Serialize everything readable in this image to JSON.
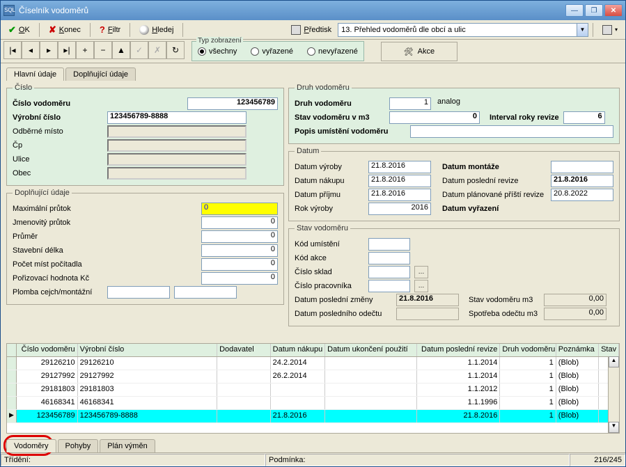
{
  "window": {
    "title": "Číselník vodoměrů"
  },
  "toolbar": {
    "ok": "OK",
    "konec": "Konec",
    "filtr": "Filtr",
    "hledej": "Hledej",
    "predtisk": "Předtisk",
    "predtisk_combo": "13. Přehled vodoměrů dle obcí a ulic"
  },
  "typ": {
    "legend": "Typ zobrazení",
    "vsechny": "všechny",
    "vyrazene": "vyřazené",
    "nevyrazene": "nevyřazené"
  },
  "akce": "Akce",
  "tabs": {
    "hlavni": "Hlavní údaje",
    "dopln": "Doplňující údaje"
  },
  "cislo": {
    "legend": "Číslo",
    "cislo_vodomeru_lbl": "Číslo vodoměru",
    "cislo_vodomeru": "123456789",
    "vyrobni_cislo_lbl": "Výrobní číslo",
    "vyrobni_cislo": "123456789-8888",
    "odberne_misto_lbl": "Odběrné místo",
    "cp_lbl": "Čp",
    "ulice_lbl": "Ulice",
    "obec_lbl": "Obec"
  },
  "dopln": {
    "legend": "Doplňující údaje",
    "max_prutok_lbl": "Maximální průtok",
    "max_prutok": "0",
    "jmen_prutok_lbl": "Jmenovitý průtok",
    "jmen_prutok": "0",
    "prumer_lbl": "Průměr",
    "prumer": "0",
    "stav_delka_lbl": "Stavební délka",
    "stav_delka": "0",
    "pocet_mist_lbl": "Počet míst počítadla",
    "pocet_mist": "0",
    "poriz_lbl": "Pořizovací hodnota Kč",
    "poriz": "0",
    "plomba_lbl": "Plomba cejch/montážní"
  },
  "druh": {
    "legend": "Druh vodoměru",
    "druh_lbl": "Druh vodoměru",
    "druh_id": "1",
    "druh_name": "analog",
    "stav_lbl": "Stav vodoměru v m3",
    "stav": "0",
    "interval_lbl": "Interval roky revize",
    "interval": "6",
    "popis_lbl": "Popis umístění vodoměru"
  },
  "datum": {
    "legend": "Datum",
    "vyroby_lbl": "Datum výroby",
    "vyroby": "21.8.2016",
    "nakupu_lbl": "Datum nákupu",
    "nakupu": "21.8.2016",
    "prijmu_lbl": "Datum příjmu",
    "prijmu": "21.8.2016",
    "rok_lbl": "Rok výroby",
    "rok": "2016",
    "montaze_lbl": "Datum montáže",
    "posledni_lbl": "Datum poslední revize",
    "posledni": "21.8.2016",
    "plan_lbl": "Datum plánované příští revize",
    "plan": "20.8.2022",
    "vyrazeni_lbl": "Datum vyřazení"
  },
  "stavv": {
    "legend": "Stav vodoměru",
    "kod_um_lbl": "Kód umístění",
    "kod_akce_lbl": "Kód akce",
    "cislo_sklad_lbl": "Číslo sklad",
    "cislo_prac_lbl": "Číslo pracovníka",
    "datum_zmeny_lbl": "Datum poslední změny",
    "datum_zmeny": "21.8.2016",
    "datum_odectu_lbl": "Datum posledního odečtu",
    "stav_m3_lbl": "Stav vodoměru m3",
    "stav_m3": "0,00",
    "spotreba_lbl": "Spotřeba  odečtu m3",
    "spotreba": "0,00"
  },
  "grid": {
    "headers": [
      "Číslo vodoměru",
      "Výrobní číslo",
      "Dodavatel",
      "Datum nákupu",
      "Datum ukončení použití",
      "Datum poslední revize",
      "Druh vodoměru",
      "Poznámka",
      "Stav"
    ],
    "rows": [
      {
        "c": "29126210",
        "v": "29126210",
        "d": "",
        "dn": "24.2.2014",
        "du": "",
        "dp": "1.1.2014",
        "dr": "1",
        "p": "(Blob)",
        "s": ""
      },
      {
        "c": "29127992",
        "v": "29127992",
        "d": "",
        "dn": "26.2.2014",
        "du": "",
        "dp": "1.1.2014",
        "dr": "1",
        "p": "(Blob)",
        "s": ""
      },
      {
        "c": "29181803",
        "v": "29181803",
        "d": "",
        "dn": "",
        "du": "",
        "dp": "1.1.2012",
        "dr": "1",
        "p": "(Blob)",
        "s": ""
      },
      {
        "c": "46168341",
        "v": "46168341",
        "d": "",
        "dn": "",
        "du": "",
        "dp": "1.1.1996",
        "dr": "1",
        "p": "(Blob)",
        "s": ""
      },
      {
        "c": "123456789",
        "v": "123456789-8888",
        "d": "",
        "dn": "21.8.2016",
        "du": "",
        "dp": "21.8.2016",
        "dr": "1",
        "p": "(Blob)",
        "s": "",
        "sel": true
      }
    ]
  },
  "bottabs": {
    "vodomery": "Vodoměry",
    "pohyby": "Pohyby",
    "plan": "Plán výměn"
  },
  "status": {
    "trideni": "Třídění:",
    "podminka": "Podmínka:",
    "counter": "216/245"
  }
}
